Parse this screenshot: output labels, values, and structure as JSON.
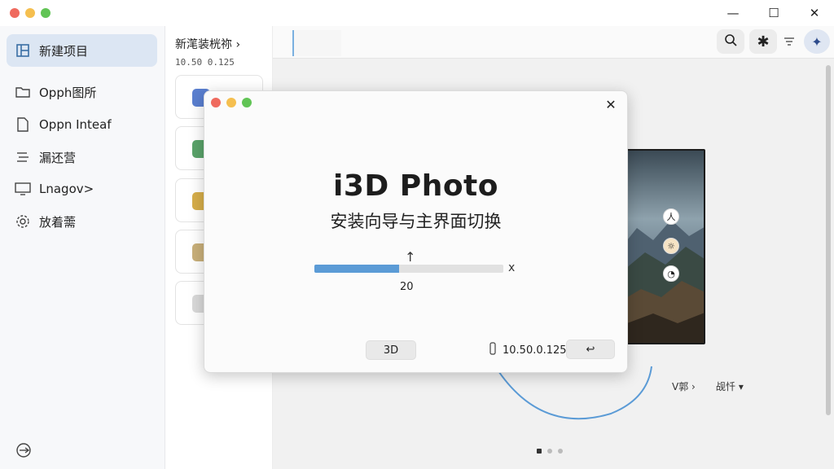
{
  "window": {
    "traffic": {
      "close": "#ef6a5e",
      "min": "#f5bf4f",
      "max": "#61c455"
    },
    "controls": {
      "minimize": "—",
      "maximize": "☐",
      "close": "✕"
    }
  },
  "sidebar": {
    "items": [
      {
        "label": "新建项目",
        "icon": "new-project-icon"
      },
      {
        "label": "Opph图所",
        "icon": "folder-icon"
      },
      {
        "label": "Oppn Inteaf",
        "icon": "document-icon"
      },
      {
        "label": "漏还营",
        "icon": "list-icon"
      },
      {
        "label": "Lnagov>",
        "icon": "monitor-icon"
      },
      {
        "label": "放着薷",
        "icon": "gear-icon"
      }
    ],
    "logout_icon": "logout-icon"
  },
  "midcol": {
    "title": "新滗装桄祢 ›",
    "subtitle": "10.50 0.125"
  },
  "modal": {
    "title": "i3D Photo",
    "subtitle": "安装向导与主界面切换",
    "progress_percent": 45,
    "progress_value": "20",
    "arrow": "↑",
    "x_mark": "x",
    "button_3d": "3D",
    "ip": "10.50.0.125",
    "back": "↩"
  },
  "content": {
    "link_left": "V郭 ›",
    "link_right": "觇忏 ▾"
  },
  "colors": {
    "accent": "#5b9bd6",
    "sidebar_active": "#dce6f3"
  }
}
